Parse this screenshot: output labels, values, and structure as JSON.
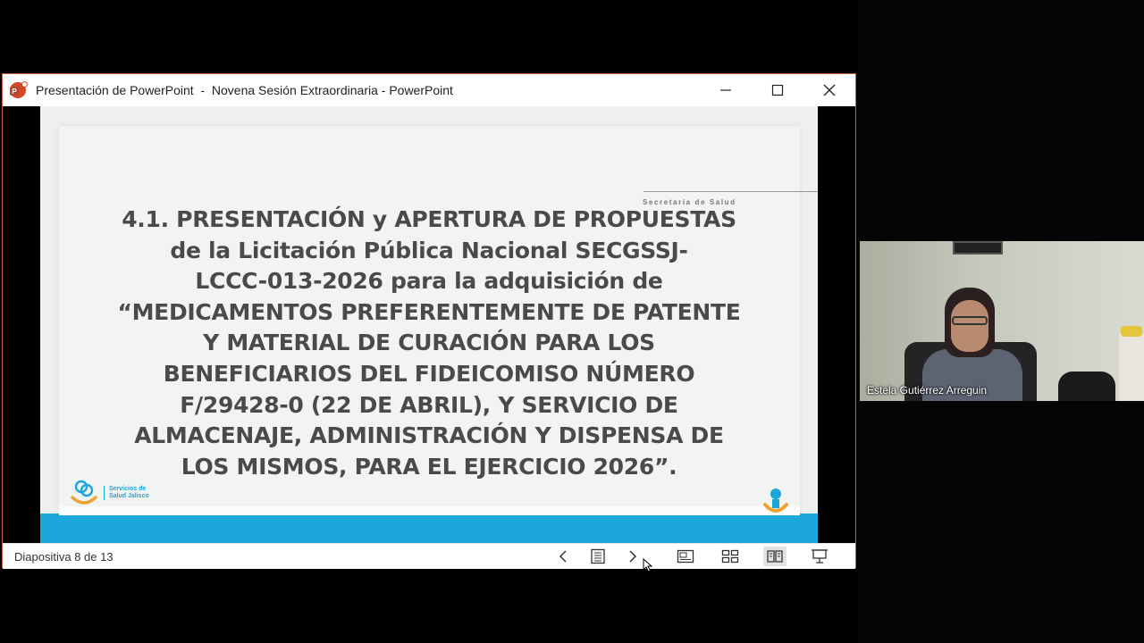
{
  "window": {
    "title": "Presentación de PowerPoint  -  Novena Sesión Extraordinaria - PowerPoint"
  },
  "slide": {
    "department": "Secretaría de Salud",
    "body_lines": [
      "4.1. PRESENTACIÓN y APERTURA DE PROPUESTAS",
      "de la Licitación Pública Nacional SECGSSJ-",
      "LCCC-013-2026 para la adquisición de",
      "“MEDICAMENTOS PREFERENTEMENTE DE PATENTE",
      "Y MATERIAL DE CURACIÓN PARA LOS",
      "BENEFICIARIOS DEL FIDEICOMISO NÚMERO",
      "F/29428-0 (22 DE ABRIL), Y SERVICIO DE",
      "ALMACENAJE, ADMINISTRACIÓN Y DISPENSA DE",
      "LOS MISMOS, PARA EL EJERCICIO 2026”."
    ],
    "logo_left_line1": "Servicios de",
    "logo_left_line2": "Salud Jalisco",
    "colors": {
      "accent": "#1ba7d9",
      "text": "#4a4a4a",
      "logo_orange": "#f0a030"
    }
  },
  "statusbar": {
    "slide_counter": "Diapositiva 8 de 13",
    "buttons": [
      "previous-slide",
      "slide-sorter-menu",
      "next-slide",
      "normal-view",
      "grid-view",
      "reading-view",
      "slideshow"
    ]
  },
  "video": {
    "participant_name": "Estela Gutiérrez Arreguin"
  }
}
